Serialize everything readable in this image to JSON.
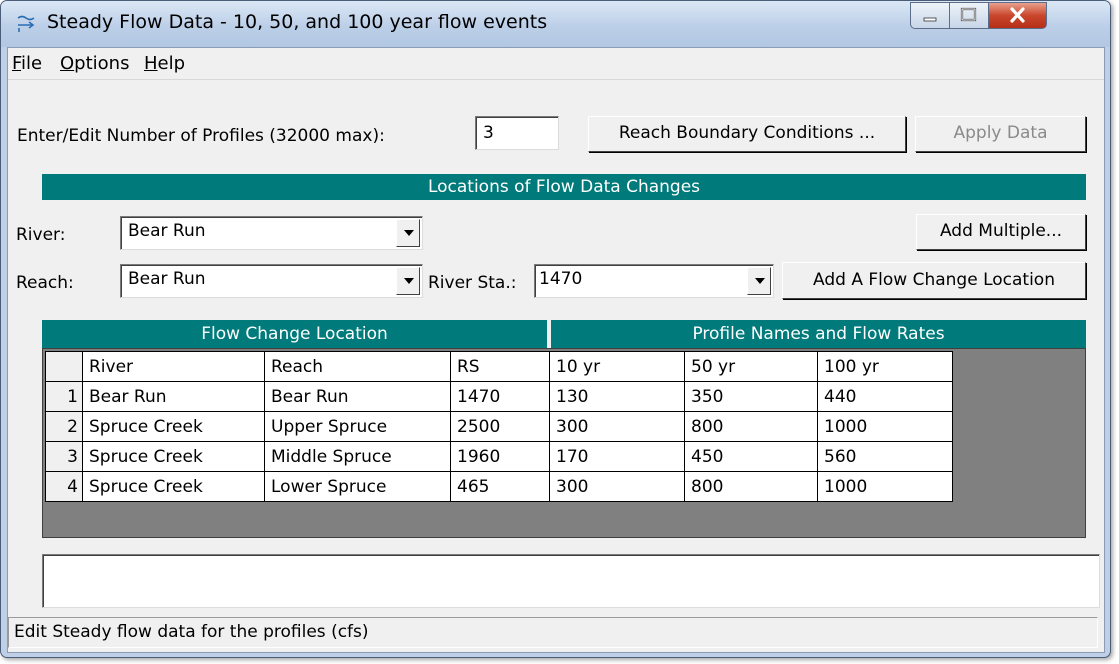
{
  "window": {
    "title": "Steady Flow Data - 10, 50, and 100 year flow events"
  },
  "menu": [
    {
      "label": "File",
      "u": "F",
      "rest": "ile"
    },
    {
      "label": "Options",
      "u": "O",
      "rest": "ptions"
    },
    {
      "label": "Help",
      "u": "H",
      "rest": "elp"
    }
  ],
  "profiles": {
    "label": "Enter/Edit Number of Profiles (32000 max):",
    "value": "3",
    "reach_boundary_button": "Reach Boundary Conditions ...",
    "apply_button": "Apply Data"
  },
  "locations": {
    "header": "Locations of Flow Data Changes",
    "river_label": "River:",
    "river_value": "Bear Run",
    "reach_label": "Reach:",
    "reach_value": "Bear Run",
    "station_label": "River Sta.:",
    "station_value": "1470",
    "add_multiple_button": "Add Multiple...",
    "add_location_button": "Add A Flow Change Location"
  },
  "grid": {
    "left_header": "Flow Change Location",
    "right_header": "Profile Names and Flow Rates",
    "columns": [
      "River",
      "Reach",
      "RS",
      "10 yr",
      "50 yr",
      "100 yr"
    ],
    "rows": [
      {
        "n": "1",
        "river": "Bear Run",
        "reach": "Bear Run",
        "rs": "1470",
        "q10": "130",
        "q50": "350",
        "q100": "440"
      },
      {
        "n": "2",
        "river": "Spruce Creek",
        "reach": "Upper Spruce",
        "rs": "2500",
        "q10": "300",
        "q50": "800",
        "q100": "1000"
      },
      {
        "n": "3",
        "river": "Spruce Creek",
        "reach": "Middle Spruce",
        "rs": "1960",
        "q10": "170",
        "q50": "450",
        "q100": "560"
      },
      {
        "n": "4",
        "river": "Spruce Creek",
        "reach": "Lower Spruce",
        "rs": "465",
        "q10": "300",
        "q50": "800",
        "q100": "1000"
      }
    ]
  },
  "description_value": "",
  "status_text": "Edit Steady flow data for the profiles (cfs)",
  "icons": [
    "app-icon",
    "minimize-icon",
    "maximize-icon",
    "close-icon",
    "dropdown-arrow-icon"
  ],
  "colors": {
    "header_teal": "#007a7a",
    "grid_gray": "#808080",
    "close_red": "#c9472c"
  }
}
